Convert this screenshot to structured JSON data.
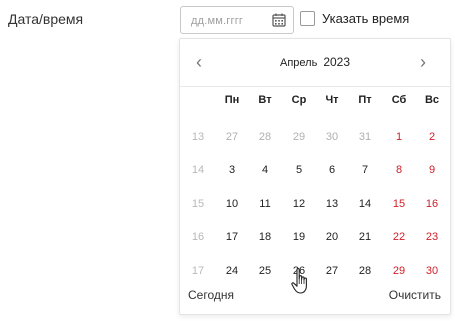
{
  "form": {
    "label": "Дата/время",
    "date_placeholder": "дд.мм.гггг",
    "time_label": "Указать время"
  },
  "calendar": {
    "month": "Апрель",
    "year": "2023",
    "weekdays": [
      "Пн",
      "Вт",
      "Ср",
      "Чт",
      "Пт",
      "Сб",
      "Вс"
    ],
    "weeks": [
      {
        "num": "13",
        "days": [
          "27",
          "28",
          "29",
          "30",
          "31",
          "1",
          "2"
        ]
      },
      {
        "num": "14",
        "days": [
          "3",
          "4",
          "5",
          "6",
          "7",
          "8",
          "9"
        ]
      },
      {
        "num": "15",
        "days": [
          "10",
          "11",
          "12",
          "13",
          "14",
          "15",
          "16"
        ]
      },
      {
        "num": "16",
        "days": [
          "17",
          "18",
          "19",
          "20",
          "21",
          "22",
          "23"
        ]
      },
      {
        "num": "17",
        "days": [
          "24",
          "25",
          "26",
          "27",
          "28",
          "29",
          "30"
        ]
      }
    ],
    "today_label": "Сегодня",
    "clear_label": "Очистить"
  },
  "colors": {
    "weekend": "#d0202a",
    "muted": "#b0b0b0"
  }
}
